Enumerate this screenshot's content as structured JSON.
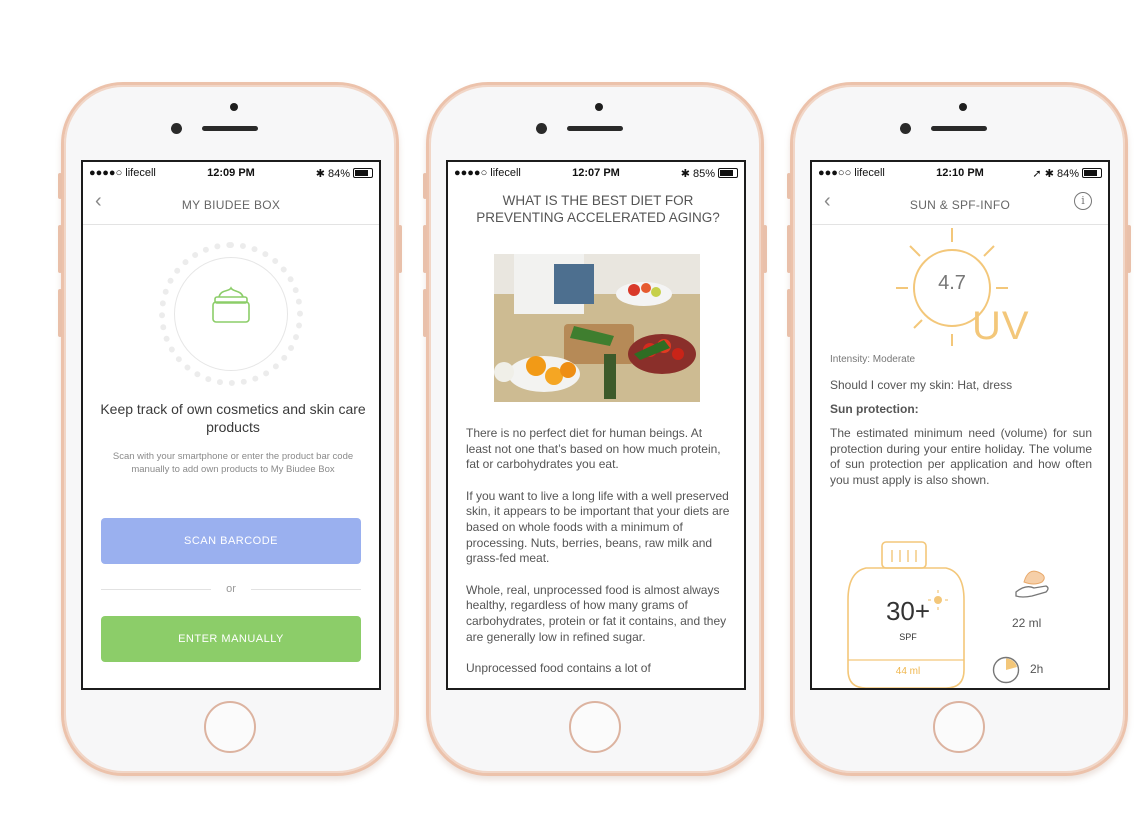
{
  "phones": [
    {
      "status": {
        "carrier": "●●●●○ lifecell",
        "time": "12:09 PM",
        "battery": "84%"
      },
      "nav": {
        "back": "‹",
        "title": "MY BIUDEE BOX"
      },
      "headline": "Keep track of own cosmetics and skin care products",
      "subtext": "Scan with your smartphone or enter the product bar code manually to add own products to My Biudee Box",
      "scan_button": "SCAN BARCODE",
      "or_label": "or",
      "manual_button": "ENTER MANUALLY",
      "icon": "cosmetic-jar-icon"
    },
    {
      "status": {
        "carrier": "●●●●○ lifecell",
        "time": "12:07 PM",
        "battery": "85%"
      },
      "title": "WHAT IS THE BEST DIET FOR PREVENTING ACCELERATED AGING?",
      "paragraphs": [
        "There is no perfect diet for human beings. At least not one that’s based on how much protein, fat or carbohydrates you eat.",
        "If you want to live a long life with a well preserved skin, it appears to be important that your diets are based on whole foods with a minimum of processing. Nuts, berries, beans, raw milk and grass-fed meat.",
        "Whole, real, unprocessed food is almost always healthy, regardless of how many grams of carbohydrates, protein or fat it contains, and they are generally low in refined sugar.",
        "Unprocessed food contains a lot of"
      ]
    },
    {
      "status": {
        "carrier": "●●●○○ lifecell",
        "time": "12:10 PM",
        "battery": "84%"
      },
      "nav": {
        "back": "‹",
        "title": "SUN & SPF-INFO",
        "info": "i"
      },
      "uv_value": "4.7",
      "uv_label": "UV",
      "intensity": "Intensity: Moderate",
      "cover": "Should I cover my skin: Hat, dress",
      "sun_protection": "Sun protection:",
      "description": "The estimated minimum need (volume) for sun protection during your entire holiday. The volume of sun protection per application and how often you must apply is also shown.",
      "spf": "30+",
      "spf_label": "SPF",
      "bottle_volume": "44 ml",
      "per_application": "22 ml",
      "interval": "2h"
    }
  ],
  "colors": {
    "scan": "#9ab0ef",
    "manual": "#8ccd69",
    "accent_sun": "#f3c77a",
    "frame": "#ecc2ab"
  }
}
